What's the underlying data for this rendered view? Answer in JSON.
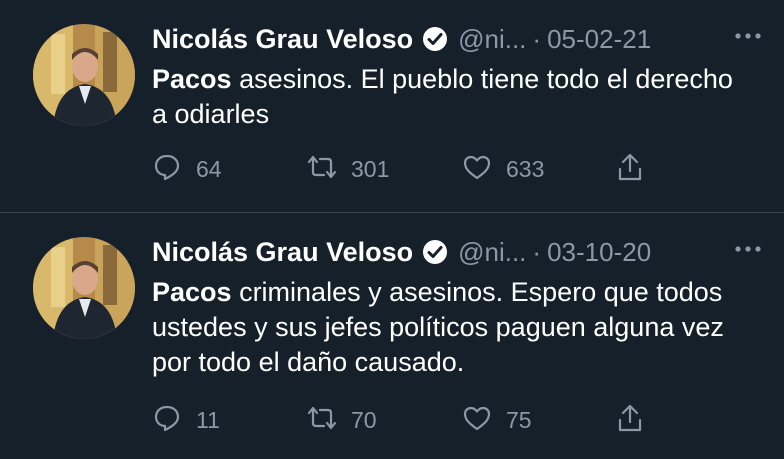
{
  "tweets": [
    {
      "author_name": "Nicolás Grau Veloso",
      "handle": "@ni...",
      "separator": "·",
      "date": "05-02-21",
      "text_bold": "Pacos",
      "text_rest": " asesinos. El pueblo tiene todo el derecho a odiarles",
      "replies": "64",
      "retweets": "301",
      "likes": "633"
    },
    {
      "author_name": "Nicolás Grau Veloso",
      "handle": "@ni...",
      "separator": "·",
      "date": "03-10-20",
      "text_bold": "Pacos",
      "text_rest": " criminales y asesinos. Espero que todos ustedes y sus jefes políticos paguen alguna vez por todo el daño causado.",
      "replies": "11",
      "retweets": "70",
      "likes": "75"
    }
  ],
  "colors": {
    "background": "#15202b",
    "text_primary": "#ffffff",
    "text_secondary": "#8b98a5",
    "divider": "#38444d"
  },
  "icons": [
    "verified-badge-icon",
    "more-icon",
    "reply-icon",
    "retweet-icon",
    "like-icon",
    "share-icon"
  ]
}
